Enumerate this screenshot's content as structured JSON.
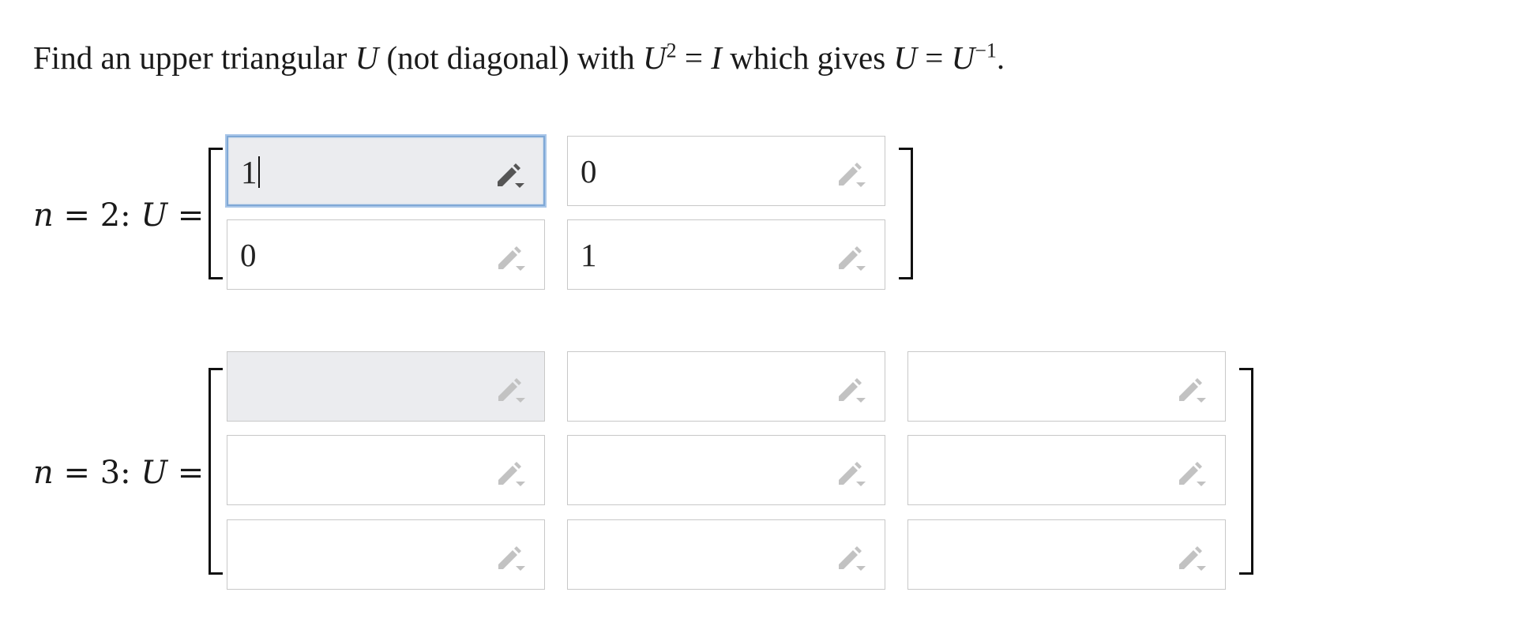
{
  "prompt": {
    "part1": "Find an upper triangular ",
    "u1": "U",
    "part2": " (not diagonal) with ",
    "u2": "U",
    "sup2": "2",
    "part3": " = ",
    "i": "I",
    "part4": " which gives ",
    "u3": "U",
    "part5": " = ",
    "u4": "U",
    "sup_inv": "−1",
    "part6": "."
  },
  "matrix2": {
    "label_n": "n",
    "label_eq": " = 2:  ",
    "label_u": "U",
    "label_end": " =",
    "cells": [
      "1",
      "0",
      "0",
      "1"
    ]
  },
  "matrix3": {
    "label_n": "n",
    "label_eq": " = 3:  ",
    "label_u": "U",
    "label_end": " =",
    "cells": [
      "",
      "",
      "",
      "",
      "",
      "",
      "",
      "",
      ""
    ]
  },
  "icons": {
    "cell_edit": "pencil-dropdown-icon"
  },
  "colors": {
    "focus_border": "#7fa8d6",
    "shaded_cell": "#ebecef",
    "cell_border": "#c8c8c8"
  }
}
